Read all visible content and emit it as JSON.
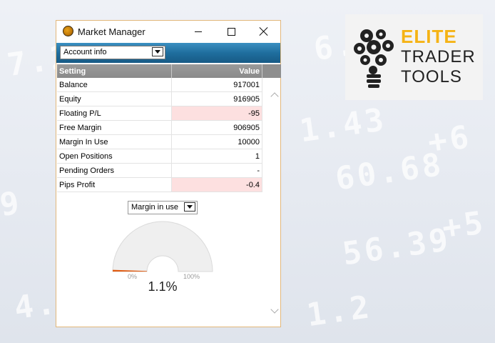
{
  "window": {
    "title": "Market Manager",
    "controls": [
      "minimize",
      "maximize",
      "close"
    ]
  },
  "toolbar": {
    "view_select": "Account info"
  },
  "table": {
    "headers": [
      "Setting",
      "Value"
    ],
    "rows": [
      {
        "setting": "Balance",
        "value": "917001",
        "negative": false
      },
      {
        "setting": "Equity",
        "value": "916905",
        "negative": false
      },
      {
        "setting": "Floating P/L",
        "value": "-95",
        "negative": true
      },
      {
        "setting": "Free Margin",
        "value": "906905",
        "negative": false
      },
      {
        "setting": "Margin In Use",
        "value": "10000",
        "negative": false
      },
      {
        "setting": "Open Positions",
        "value": "1",
        "negative": false
      },
      {
        "setting": "Pending Orders",
        "value": "-",
        "negative": false
      },
      {
        "setting": "Pips Profit",
        "value": "-0.4",
        "negative": true
      }
    ]
  },
  "gauge": {
    "select": "Margin in use",
    "min_label": "0%",
    "max_label": "100%",
    "value_label": "1.1%",
    "value_fraction": 0.011
  },
  "logo": {
    "line1": "ELITE",
    "line2": "TRADER",
    "line3": "TOOLS"
  },
  "colors": {
    "accent_blue": "#1f6e9e",
    "negative_row": "#fde0e0",
    "logo_yellow": "#f5b315",
    "gauge_needle": "#e05a10"
  }
}
